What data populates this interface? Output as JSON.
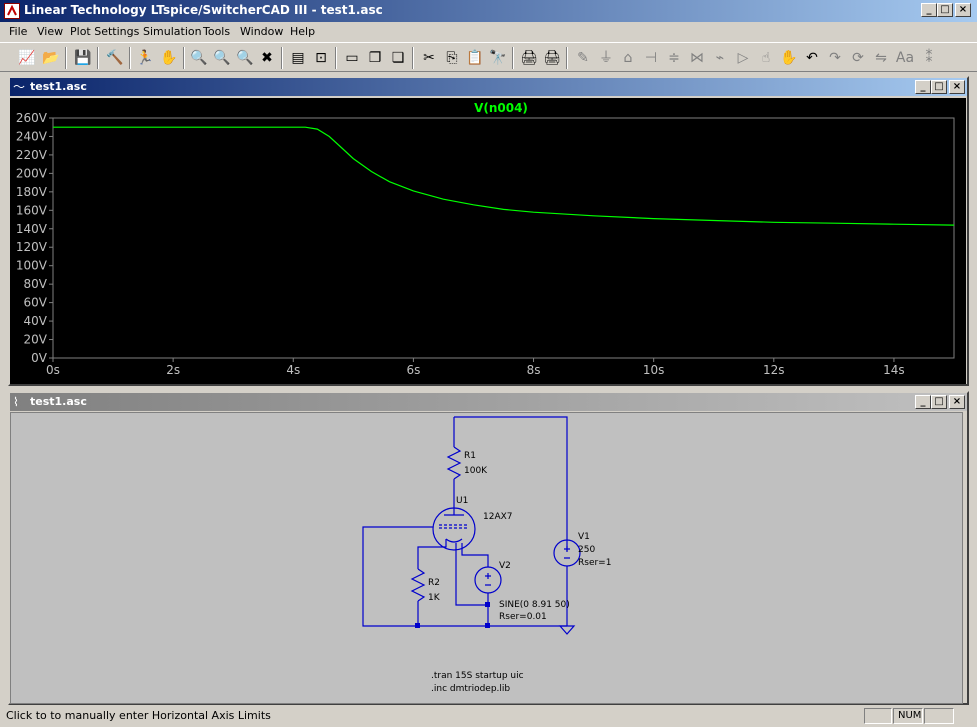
{
  "window": {
    "title": "Linear Technology LTspice/SwitcherCAD III - test1.asc"
  },
  "menu": [
    "File",
    "View",
    "Plot Settings",
    "Simulation",
    "Tools",
    "Window",
    "Help"
  ],
  "toolbar_icons": [
    "new-schematic-icon",
    "open-icon",
    "save-icon",
    "control-panel-icon",
    "run-icon",
    "pan-hand-icon",
    "zoom-in-icon",
    "zoom-rect-icon",
    "zoom-out-icon",
    "zoom-cancel-icon",
    "autorange-icon",
    "plot-settings-icon",
    "tile-horizontal-icon",
    "cascade-icon",
    "tile-vertical-icon",
    "cut-icon",
    "copy-icon",
    "paste-icon",
    "find-icon",
    "print-preview-icon",
    "print-icon",
    "wire-icon",
    "ground-icon",
    "label-icon",
    "capacitor-icon",
    "resistor-icon",
    "diode-icon",
    "component-icon",
    "move-icon",
    "drag-icon",
    "undo-icon",
    "redo-icon",
    "rotate-icon",
    "mirror-icon",
    "text-icon",
    "spice-directive-icon"
  ],
  "plot_window": {
    "title": "test1.asc",
    "trace_label": "V(n004)",
    "trace_color": "#00ff00"
  },
  "chart_data": {
    "type": "line",
    "title": "V(n004)",
    "xlabel": "",
    "ylabel": "",
    "x_ticks": [
      "0s",
      "2s",
      "4s",
      "6s",
      "8s",
      "10s",
      "12s",
      "14s"
    ],
    "y_ticks": [
      "0V",
      "20V",
      "40V",
      "60V",
      "80V",
      "100V",
      "120V",
      "140V",
      "160V",
      "180V",
      "200V",
      "220V",
      "240V",
      "260V"
    ],
    "xlim": [
      0,
      15
    ],
    "ylim": [
      0,
      260
    ],
    "grid": false,
    "series": [
      {
        "name": "V(n004)",
        "x": [
          0,
          1,
          2,
          3,
          4,
          4.2,
          4.4,
          4.6,
          4.8,
          5.0,
          5.3,
          5.6,
          6.0,
          6.5,
          7.0,
          7.5,
          8.0,
          9.0,
          10.0,
          11.0,
          12.0,
          13.0,
          14.0,
          15.0
        ],
        "y": [
          250,
          250,
          250,
          250,
          250,
          250,
          248,
          240,
          228,
          216,
          202,
          191,
          181,
          172,
          166,
          161,
          158,
          154,
          151,
          149,
          147,
          146,
          145,
          144
        ]
      }
    ]
  },
  "schematic_window": {
    "title": "test1.asc",
    "components": {
      "r1_name": "R1",
      "r1_value": "100K",
      "u1_name": "U1",
      "u1_value": "12AX7",
      "r2_name": "R2",
      "r2_value": "1K",
      "v1_name": "V1",
      "v1_value": "250",
      "v1_rser": "Rser=1",
      "v2_name": "V2",
      "v2_value": "SINE(0 8.91 50)",
      "v2_rser": "Rser=0.01"
    },
    "directives": [
      ".tran 15S startup uic",
      ".inc dmtriodep.lib"
    ]
  },
  "statusbar": {
    "message": "Click to to manually enter Horizontal Axis Limits",
    "num": "NUM"
  }
}
